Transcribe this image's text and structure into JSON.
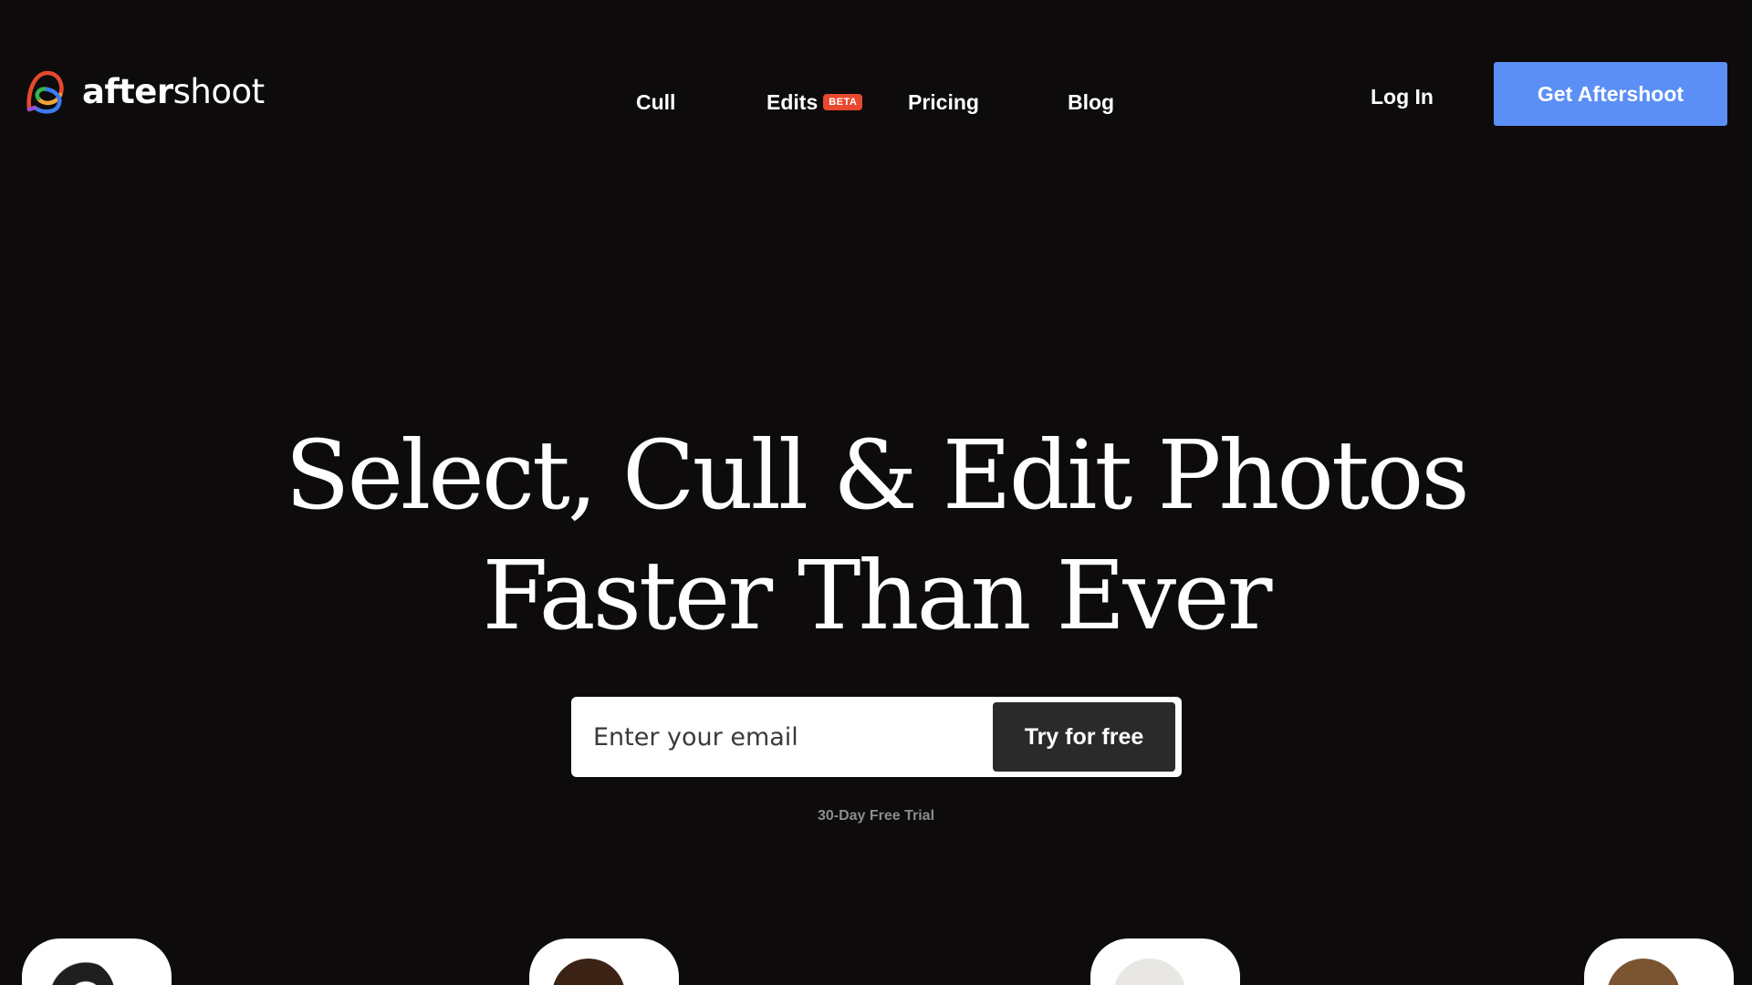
{
  "brand": {
    "name_bold": "after",
    "name_light": "shoot",
    "logo_icon": "aftershoot-logo-icon",
    "colors": [
      "#e8482e",
      "#f2a33a",
      "#37b34a",
      "#3c7bf0",
      "#9c4dcc"
    ]
  },
  "nav": {
    "items": [
      {
        "label": "Cull"
      },
      {
        "label": "Edits",
        "badge": "BETA"
      },
      {
        "label": "Pricing"
      },
      {
        "label": "Blog"
      }
    ],
    "login_label": "Log In",
    "cta_label": "Get Aftershoot"
  },
  "hero": {
    "title_line1": "Select, Cull & Edit Photos",
    "title_line2": "Faster Than Ever",
    "email_placeholder": "Enter your email",
    "submit_label": "Try for free",
    "trial_note": "30-Day Free Trial"
  },
  "theme": {
    "background": "#0d0b0c",
    "accent": "#5b8ff5",
    "badge": "#e8482e",
    "button_dark": "#2b2a2b"
  }
}
